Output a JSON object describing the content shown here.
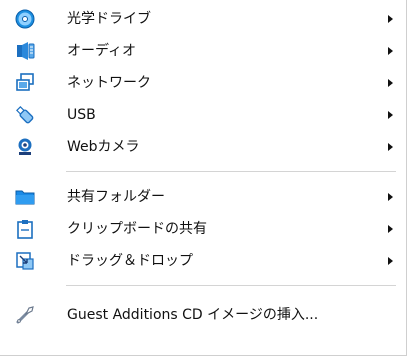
{
  "menu": {
    "items": [
      {
        "label": "光学ドライブ",
        "icon": "optical-drive-icon",
        "submenu": true
      },
      {
        "label": "オーディオ",
        "icon": "audio-icon",
        "submenu": true
      },
      {
        "label": "ネットワーク",
        "icon": "network-icon",
        "submenu": true
      },
      {
        "label": "USB",
        "icon": "usb-icon",
        "submenu": true
      },
      {
        "label": "Webカメラ",
        "icon": "webcam-icon",
        "submenu": true
      },
      {
        "label": "共有フォルダー",
        "icon": "shared-folder-icon",
        "submenu": true
      },
      {
        "label": "クリップボードの共有",
        "icon": "clipboard-icon",
        "submenu": true
      },
      {
        "label": "ドラッグ＆ドロップ",
        "icon": "drag-drop-icon",
        "submenu": true
      },
      {
        "label": "Guest Additions CD イメージの挿入...",
        "icon": "guest-additions-icon",
        "submenu": false
      }
    ]
  },
  "colors": {
    "accent": "#1a73c7",
    "separator": "#d4d4d4",
    "text": "#111111"
  }
}
